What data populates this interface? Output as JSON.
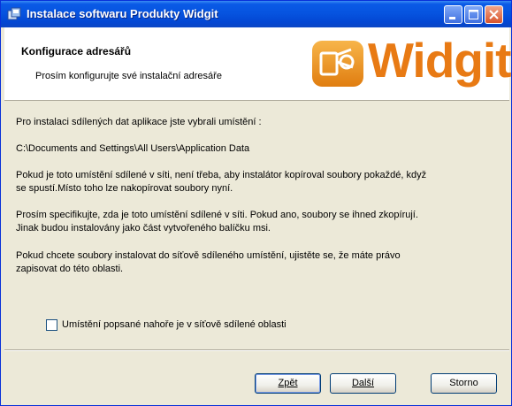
{
  "window": {
    "title": "Instalace softwaru Produkty Widgit"
  },
  "header": {
    "title": "Konfigurace adresářů",
    "subtitle": "Prosím konfigurujte své instalační adresáře",
    "logo_text": "Widgit"
  },
  "content": {
    "para1": "Pro instalaci sdílených dat aplikace jste vybrali umístění :",
    "path": "C:\\Documents and Settings\\All Users\\Application Data",
    "para3_line1": "Pokud je toto umístění sdílené v síti, není třeba, aby instalátor kopíroval soubory pokaždé, když",
    "para3_line2": "se spustí.Místo toho lze nakopírovat soubory nyní.",
    "para4_line1": " Prosím specifikujte, zda je toto umístění sdílené v síti. Pokud ano, soubory se ihned zkopírují.",
    "para4_line2": "Jinak budou instalovány jako část vytvořeného balíčku msi.",
    "para5_line1": " Pokud chcete soubory instalovat do síťově sdíleného umístění, ujistěte se, že máte právo",
    "para5_line2": "zapisovat do této oblasti.",
    "checkbox_label": "Umístění popsané nahoře je v síťově sdílené oblasti",
    "checkbox_checked": false
  },
  "buttons": {
    "back": "Zpět",
    "next": "Další",
    "cancel": "Storno"
  }
}
